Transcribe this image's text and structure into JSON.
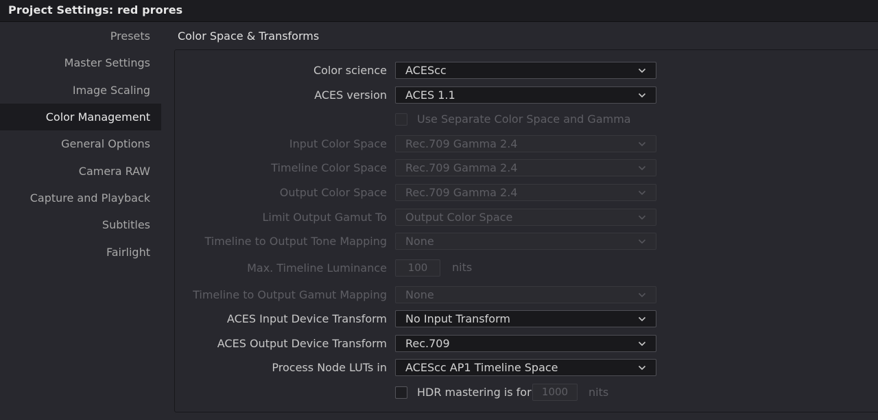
{
  "window": {
    "title": "Project Settings:  red prores"
  },
  "sidebar": {
    "items": [
      {
        "label": "Presets"
      },
      {
        "label": "Master Settings"
      },
      {
        "label": "Image Scaling"
      },
      {
        "label": "Color Management",
        "active": true
      },
      {
        "label": "General Options"
      },
      {
        "label": "Camera RAW"
      },
      {
        "label": "Capture and Playback"
      },
      {
        "label": "Subtitles"
      },
      {
        "label": "Fairlight"
      }
    ]
  },
  "section": {
    "title": "Color Space & Transforms"
  },
  "rows": {
    "color_science": {
      "label": "Color science",
      "value": "ACEScc"
    },
    "aces_version": {
      "label": "ACES version",
      "value": "ACES 1.1"
    },
    "separate_cs": {
      "label": "Use Separate Color Space and Gamma",
      "checked": false
    },
    "input_cs": {
      "label": "Input Color Space",
      "value": "Rec.709 Gamma 2.4"
    },
    "timeline_cs": {
      "label": "Timeline Color Space",
      "value": "Rec.709 Gamma 2.4"
    },
    "output_cs": {
      "label": "Output Color Space",
      "value": "Rec.709 Gamma 2.4"
    },
    "limit_gamut": {
      "label": "Limit Output Gamut To",
      "value": "Output Color Space"
    },
    "tone_mapping": {
      "label": "Timeline to Output Tone Mapping",
      "value": "None"
    },
    "max_luminance": {
      "label": "Max. Timeline Luminance",
      "value": "100",
      "unit": "nits"
    },
    "gamut_mapping": {
      "label": "Timeline to Output Gamut Mapping",
      "value": "None"
    },
    "aces_idt": {
      "label": "ACES Input Device Transform",
      "value": "No Input Transform"
    },
    "aces_odt": {
      "label": "ACES Output Device Transform",
      "value": "Rec.709"
    },
    "node_luts": {
      "label": "Process Node LUTs in",
      "value": "ACEScc AP1 Timeline Space"
    },
    "hdr_mastering": {
      "label": "HDR mastering is for",
      "value": "1000",
      "unit": "nits",
      "checked": false
    }
  },
  "icons": {
    "dropdown": "chevron-down-icon"
  },
  "colors": {
    "background": "#28282e",
    "titlebar": "#1c1c20",
    "active_item": "#1b1b1f",
    "field": "#19191c",
    "disabled_text": "#5e5e64"
  }
}
